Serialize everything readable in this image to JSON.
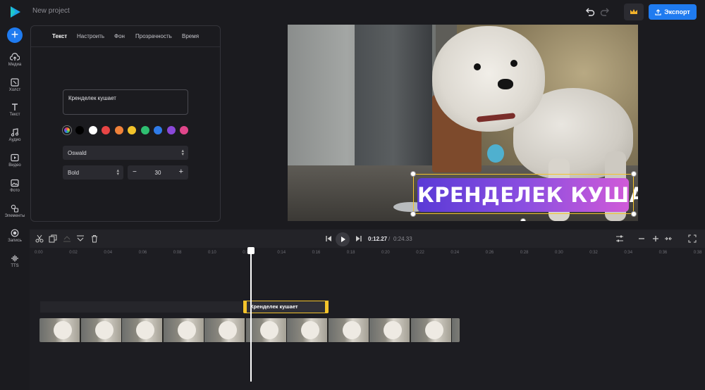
{
  "app": {
    "project_title": "New project",
    "export_label": "Экспорт"
  },
  "sidebar": {
    "items": [
      {
        "label": "Медиа",
        "icon": "cloud-upload-icon"
      },
      {
        "label": "Холст",
        "icon": "canvas-icon"
      },
      {
        "label": "Текст",
        "icon": "text-icon"
      },
      {
        "label": "Аудио",
        "icon": "music-icon"
      },
      {
        "label": "Видео",
        "icon": "video-icon"
      },
      {
        "label": "Фото",
        "icon": "image-icon"
      },
      {
        "label": "Элементы",
        "icon": "shapes-icon"
      },
      {
        "label": "Запись",
        "icon": "record-icon"
      },
      {
        "label": "TTS",
        "icon": "waveform-icon"
      }
    ]
  },
  "panel": {
    "tabs": [
      "Текст",
      "Настроить",
      "Фон",
      "Прозрачность",
      "Время"
    ],
    "active_tab": "Текст",
    "text_value": "Крენделек кушает",
    "colors": [
      "#000000",
      "#ffffff",
      "#e84545",
      "#f0823a",
      "#f3c32b",
      "#2fbf71",
      "#2f7be8",
      "#8a48d8",
      "#e0468a"
    ],
    "font_family": "Oswald",
    "font_weight": "Bold",
    "font_size": "30"
  },
  "preview": {
    "caption": "КРЕНДЕЛЕК КУШАЕТ"
  },
  "timeline": {
    "current_time": "0:12.27",
    "separator": "/",
    "total_time": "0:24.33",
    "ticks": [
      "0:00",
      "0:02",
      "0:04",
      "0:06",
      "0:08",
      "0:10",
      "0:12",
      "0:14",
      "0:16",
      "0:18",
      "0:20",
      "0:22",
      "0:24",
      "0:26",
      "0:28",
      "0:30",
      "0:32",
      "0:34",
      "0:36",
      "0:38"
    ],
    "text_clip_label": "Крენделек кушает"
  }
}
